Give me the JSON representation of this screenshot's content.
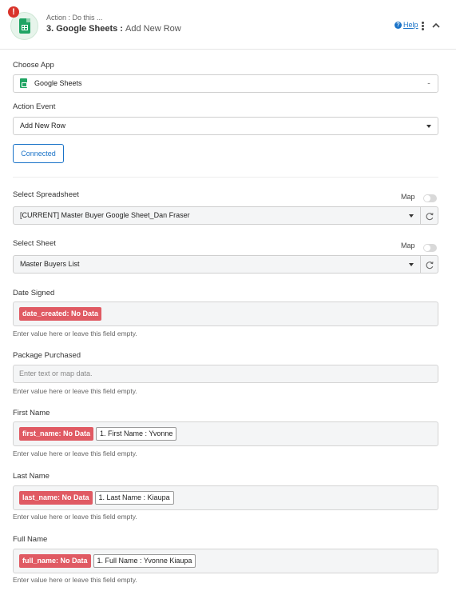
{
  "header": {
    "alert_badge": "!",
    "action_label": "Action : Do this ...",
    "step_title": "3. Google Sheets :",
    "step_subtitle": "Add New Row",
    "help_label": "Help",
    "help_icon": "question-circle-icon",
    "menu_icon": "kebab-icon",
    "collapse_icon": "chevron-up-icon",
    "accent_color": "#1a73c8",
    "alert_color": "#d9342b"
  },
  "choose_app": {
    "label": "Choose App",
    "value": "Google Sheets",
    "icon": "google-sheets-icon"
  },
  "action_event": {
    "label": "Action Event",
    "value": "Add New Row"
  },
  "connection": {
    "button_label": "Connected"
  },
  "spreadsheet": {
    "label": "Select Spreadsheet",
    "map_label": "Map",
    "value": "[CURRENT] Master Buyer Google Sheet_Dan Fraser"
  },
  "sheet": {
    "label": "Select Sheet",
    "map_label": "Map",
    "value": "Master Buyers List"
  },
  "fields": {
    "date_signed": {
      "label": "Date Signed",
      "tokens": [
        "date_created: No Data"
      ],
      "hint": "Enter value here or leave this field empty."
    },
    "package_purchased": {
      "label": "Package Purchased",
      "placeholder": "Enter text or map data.",
      "hint": "Enter value here or leave this field empty."
    },
    "first_name": {
      "label": "First Name",
      "token_red": "first_name: No Data",
      "token_white": "1. First Name : Yvonne",
      "hint": "Enter value here or leave this field empty."
    },
    "last_name": {
      "label": "Last Name",
      "token_red": "last_name: No Data",
      "token_white": "1. Last Name : Kiaupa",
      "hint": "Enter value here or leave this field empty."
    },
    "full_name": {
      "label": "Full Name",
      "token_red": "full_name: No Data",
      "token_white": "1. Full Name : Yvonne Kiaupa",
      "hint": "Enter value here or leave this field empty."
    }
  },
  "colors": {
    "token_red": "#e05a63",
    "field_bg": "#f4f5f6"
  }
}
